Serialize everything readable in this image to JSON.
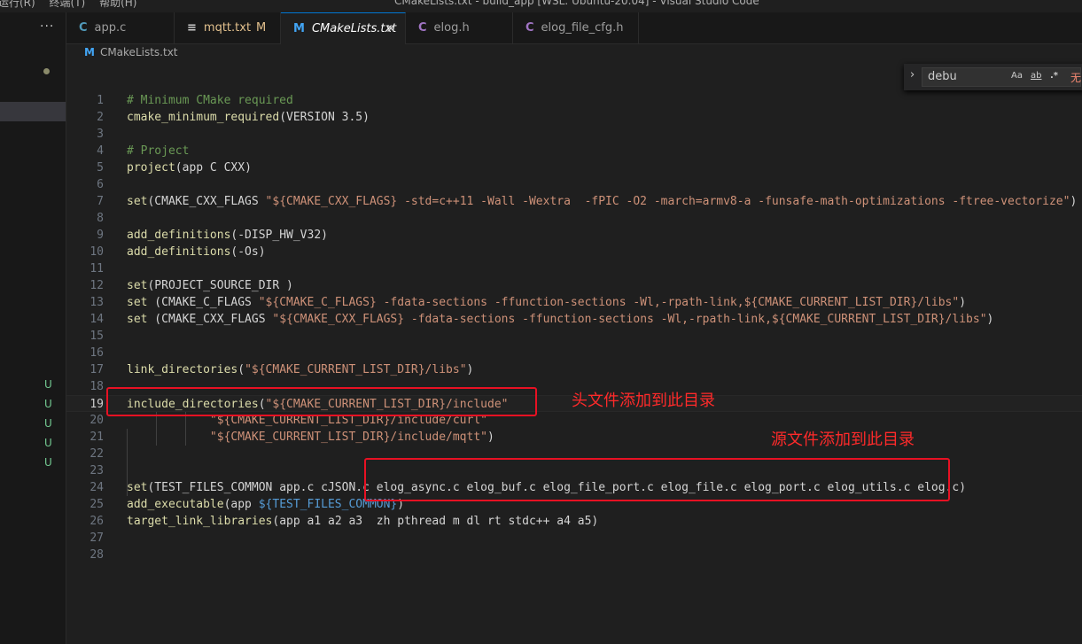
{
  "window": {
    "menu": [
      "运行(R)",
      "终端(T)",
      "帮助(H)"
    ],
    "title": "CMakeLists.txt - build_app [WSL: Ubuntu-20.04] - Visual Studio Code"
  },
  "sidebar": {
    "more": "···",
    "git_status": [
      "U",
      "U",
      "U",
      "U",
      "U"
    ]
  },
  "tabs": [
    {
      "icon": "C",
      "label": "app.c",
      "modified": ""
    },
    {
      "icon": "≡",
      "label": "mqtt.txt",
      "modified": "M"
    },
    {
      "icon": "M",
      "label": "CMakeLists.txt",
      "modified": ""
    },
    {
      "icon": "C",
      "label": "elog.h",
      "modified": ""
    },
    {
      "icon": "C",
      "label": "elog_file_cfg.h",
      "modified": ""
    }
  ],
  "breadcrumb": {
    "icon": "M",
    "label": "CMakeLists.txt"
  },
  "find": {
    "value": "debu",
    "match_case": "Aa",
    "whole_word": "ab",
    "regex": ".*",
    "result": "无"
  },
  "code_lines": [
    {
      "n": "1",
      "segments": [
        {
          "t": "# Minimum CMake required",
          "c": "cm"
        }
      ]
    },
    {
      "n": "2",
      "segments": [
        {
          "t": "cmake_minimum_required",
          "c": "fn"
        },
        {
          "t": "(VERSION 3.5)",
          "c": "tx"
        }
      ]
    },
    {
      "n": "3",
      "segments": []
    },
    {
      "n": "4",
      "segments": [
        {
          "t": "# Project",
          "c": "cm"
        }
      ]
    },
    {
      "n": "5",
      "segments": [
        {
          "t": "project",
          "c": "fn"
        },
        {
          "t": "(app C CXX)",
          "c": "tx"
        }
      ]
    },
    {
      "n": "6",
      "segments": []
    },
    {
      "n": "7",
      "segments": [
        {
          "t": "set",
          "c": "fn"
        },
        {
          "t": "(CMAKE_CXX_FLAGS ",
          "c": "tx"
        },
        {
          "t": "\"${CMAKE_CXX_FLAGS} -std=c++11 -Wall -Wextra  -fPIC -O2 -march=armv8-a -funsafe-math-optimizations -ftree-vectorize\"",
          "c": "st"
        },
        {
          "t": ")",
          "c": "tx"
        }
      ]
    },
    {
      "n": "8",
      "segments": []
    },
    {
      "n": "9",
      "segments": [
        {
          "t": "add_definitions",
          "c": "fn"
        },
        {
          "t": "(-DISP_HW_V32)",
          "c": "tx"
        }
      ]
    },
    {
      "n": "10",
      "segments": [
        {
          "t": "add_definitions",
          "c": "fn"
        },
        {
          "t": "(-Os)",
          "c": "tx"
        }
      ]
    },
    {
      "n": "11",
      "segments": []
    },
    {
      "n": "12",
      "segments": [
        {
          "t": "set",
          "c": "fn"
        },
        {
          "t": "(PROJECT_SOURCE_DIR )",
          "c": "tx"
        }
      ]
    },
    {
      "n": "13",
      "segments": [
        {
          "t": "set",
          "c": "fn"
        },
        {
          "t": " (CMAKE_C_FLAGS ",
          "c": "tx"
        },
        {
          "t": "\"${CMAKE_C_FLAGS} -fdata-sections -ffunction-sections -Wl,-rpath-link,${CMAKE_CURRENT_LIST_DIR}/libs\"",
          "c": "st"
        },
        {
          "t": ")",
          "c": "tx"
        }
      ]
    },
    {
      "n": "14",
      "segments": [
        {
          "t": "set",
          "c": "fn"
        },
        {
          "t": " (CMAKE_CXX_FLAGS ",
          "c": "tx"
        },
        {
          "t": "\"${CMAKE_CXX_FLAGS} -fdata-sections -ffunction-sections -Wl,-rpath-link,${CMAKE_CURRENT_LIST_DIR}/libs\"",
          "c": "st"
        },
        {
          "t": ")",
          "c": "tx"
        }
      ]
    },
    {
      "n": "15",
      "segments": []
    },
    {
      "n": "16",
      "segments": []
    },
    {
      "n": "17",
      "segments": [
        {
          "t": "link_directories",
          "c": "fn"
        },
        {
          "t": "(",
          "c": "tx"
        },
        {
          "t": "\"${CMAKE_CURRENT_LIST_DIR}/libs\"",
          "c": "st"
        },
        {
          "t": ")",
          "c": "tx"
        }
      ]
    },
    {
      "n": "18",
      "segments": []
    },
    {
      "n": "19",
      "segments": [
        {
          "t": "include_directories",
          "c": "fn"
        },
        {
          "t": "(",
          "c": "tx"
        },
        {
          "t": "\"${CMAKE_CURRENT_LIST_DIR}/include\"",
          "c": "st"
        }
      ]
    },
    {
      "n": "20",
      "segments": [
        {
          "t": "            \"${CMAKE_CURRENT_LIST_DIR}/include/curl\"",
          "c": "st"
        }
      ]
    },
    {
      "n": "21",
      "segments": [
        {
          "t": "            \"${CMAKE_CURRENT_LIST_DIR}/include/mqtt\"",
          "c": "st"
        },
        {
          "t": ")",
          "c": "tx"
        }
      ]
    },
    {
      "n": "22",
      "segments": []
    },
    {
      "n": "23",
      "segments": []
    },
    {
      "n": "24",
      "segments": [
        {
          "t": "set",
          "c": "fn"
        },
        {
          "t": "(TEST_FILES_COMMON app.c cJSON.c elog_async.c elog_buf.c elog_file_port.c elog_file.c elog_port.c elog_utils.c elog.c)",
          "c": "tx"
        }
      ]
    },
    {
      "n": "25",
      "segments": [
        {
          "t": "add_executable",
          "c": "fn"
        },
        {
          "t": "(app ",
          "c": "tx"
        },
        {
          "t": "${TEST_FILES_COMMON}",
          "c": "vr"
        },
        {
          "t": ")",
          "c": "tx"
        }
      ]
    },
    {
      "n": "26",
      "segments": [
        {
          "t": "target_link_libraries",
          "c": "fn"
        },
        {
          "t": "(app a1 a2 a3  zh pthread m dl rt stdc++ a4 a5)",
          "c": "tx"
        }
      ]
    },
    {
      "n": "27",
      "segments": []
    },
    {
      "n": "28",
      "segments": []
    }
  ],
  "current_line": "19",
  "annotations": {
    "header_note": "头文件添加到此目录",
    "source_note": "源文件添加到此目录"
  }
}
